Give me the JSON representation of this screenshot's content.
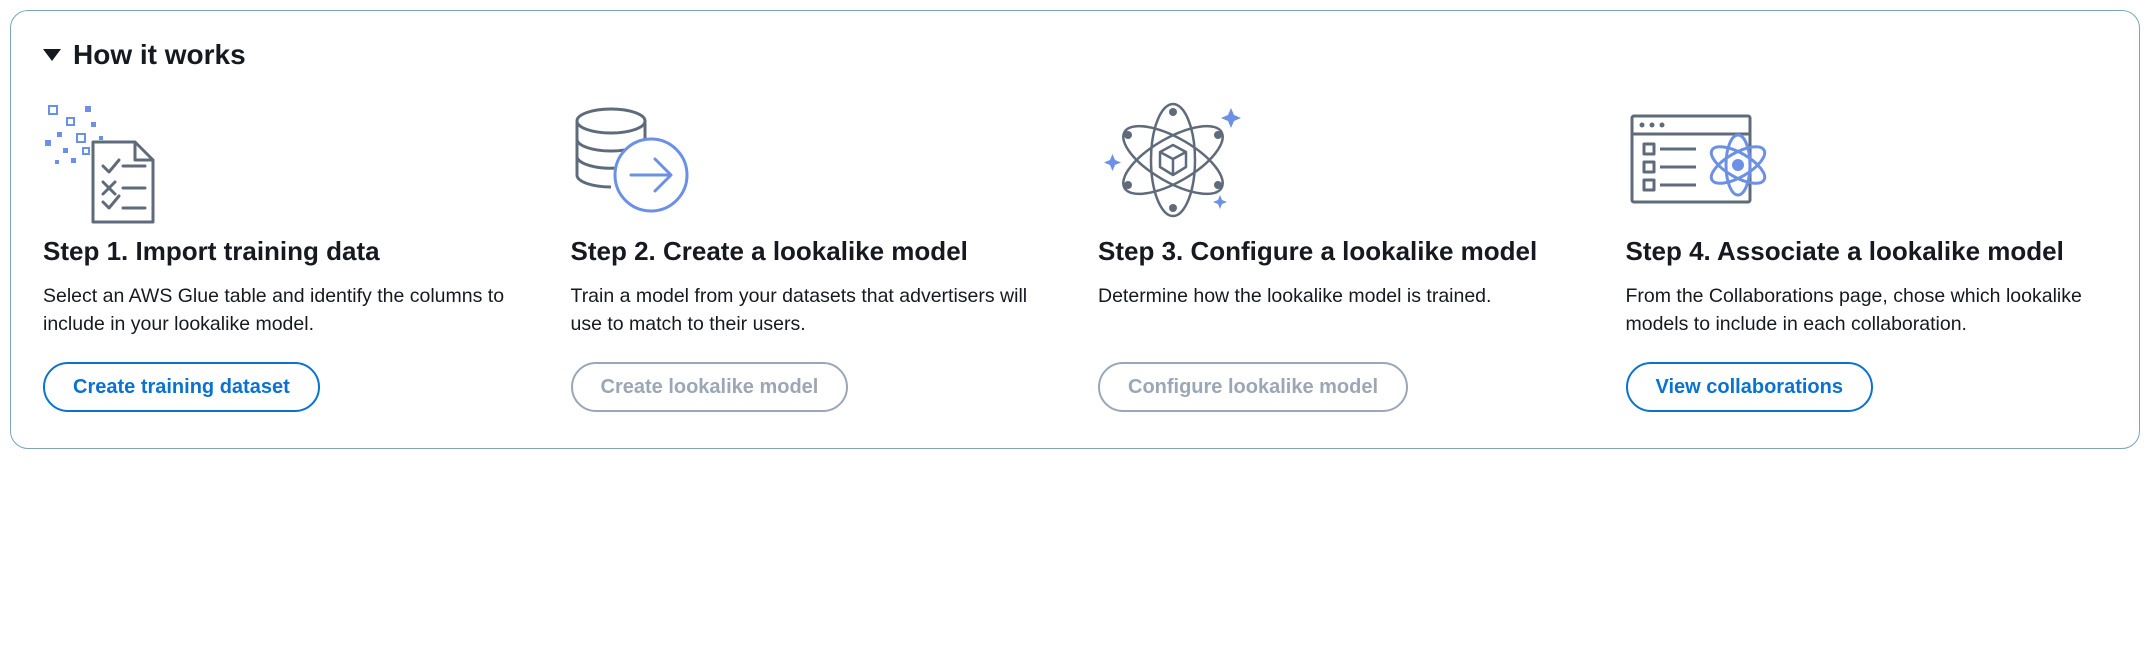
{
  "panel": {
    "title": "How it works"
  },
  "steps": [
    {
      "title": "Step 1. Import training data",
      "desc": "Select an AWS Glue table and identify the columns to include in your lookalike model.",
      "button_label": "Create training dataset"
    },
    {
      "title": "Step 2. Create a lookalike model",
      "desc": "Train a model from your datasets that advertisers will use to match to their users.",
      "button_label": "Create lookalike model"
    },
    {
      "title": "Step 3. Configure a lookalike model",
      "desc": "Determine how the lookalike model is trained.",
      "button_label": "Configure lookalike model"
    },
    {
      "title": "Step 4. Associate a lookalike model",
      "desc": "From the Collaborations page, chose which lookalike models to include in each collaboration.",
      "button_label": "View collaborations"
    }
  ]
}
